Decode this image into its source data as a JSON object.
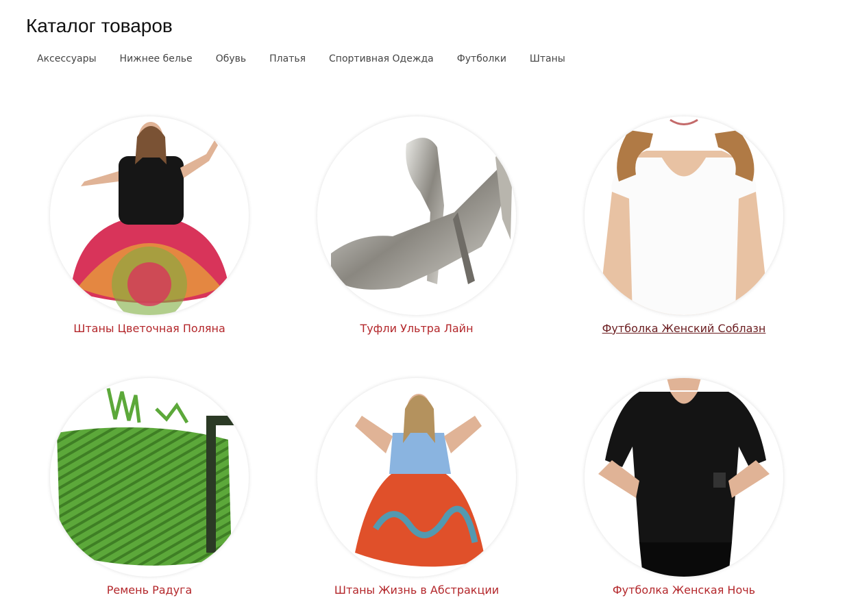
{
  "page": {
    "title": "Каталог товаров"
  },
  "categories": [
    "Аксессуары",
    "Нижнее белье",
    "Обувь",
    "Платья",
    "Спортивная Одежда",
    "Футболки",
    "Штаны"
  ],
  "products": [
    {
      "name": "Штаны Цветочная Поляна",
      "image": "woman-black-tshirt-red-mandala-skirt"
    },
    {
      "name": "Туфли Ультра Лайн",
      "image": "silver-high-heel-shoes"
    },
    {
      "name": "Футболка Женский Соблазн",
      "image": "woman-white-tshirt",
      "state": "hover"
    },
    {
      "name": "Ремень Радуга",
      "image": "green-rope-belt"
    },
    {
      "name": "Штаны Жизнь в Абстракции",
      "image": "woman-blue-top-orange-skirt"
    },
    {
      "name": "Футболка Женская Ночь",
      "image": "woman-black-tshirt"
    }
  ],
  "colors": {
    "link": "#b3262a",
    "link_hover": "#6a1c1f",
    "nav_text": "#444444",
    "title": "#111111"
  }
}
